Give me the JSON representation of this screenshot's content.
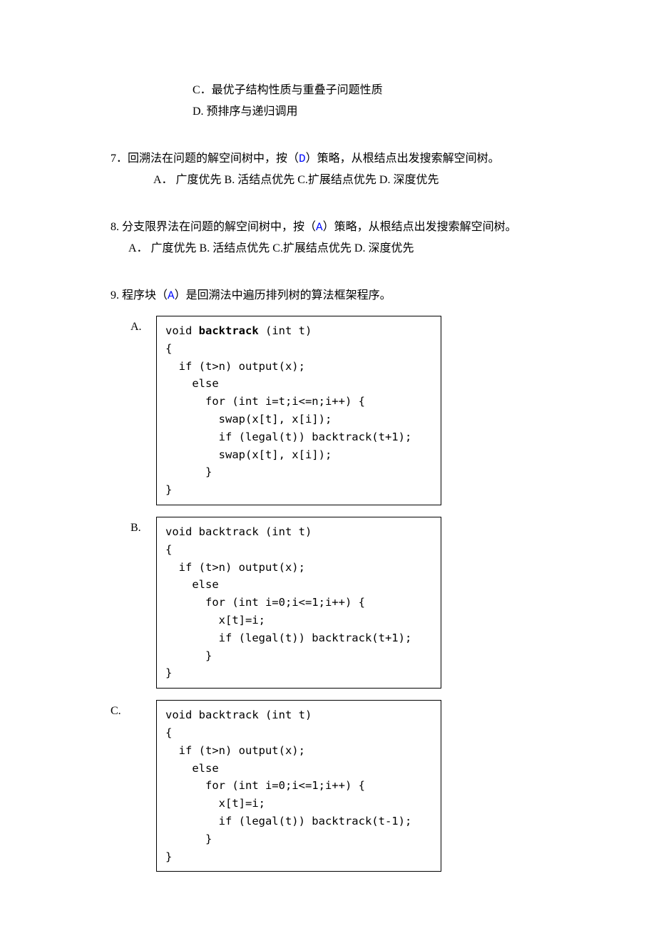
{
  "top_options": {
    "c": "C．最优子结构性质与重叠子问题性质",
    "d": "D.  预排序与递归调用"
  },
  "q7": {
    "text_pre": "7．回溯法在问题的解空间树中，按（",
    "answer": "D",
    "text_post": "）策略，从根结点出发搜索解空间树。",
    "opts": "A． 广度优先 B. 活结点优先  C.扩展结点优先  D. 深度优先"
  },
  "q8": {
    "text_pre": "8. 分支限界法在问题的解空间树中，按（",
    "answer": "A",
    "text_post": "）策略，从根结点出发搜索解空间树。",
    "opts": "A． 广度优先 B. 活结点优先  C.扩展结点优先  D. 深度优先"
  },
  "q9": {
    "text_pre": "9. 程序块（",
    "answer": "A",
    "text_post": "）是回溯法中遍历排列树的算法框架程序。",
    "A_label": "A.",
    "B_label": "B.",
    "C_label": "C.",
    "codeA": {
      "l1a": "void ",
      "l1b": "backtrack",
      "l1c": " (int t)",
      "l2": "{",
      "l3": "  if (t>n) output(x);",
      "l4": "    else",
      "l5": "      for (int i=t;i<=n;i++) {",
      "l6": "        swap(x[t], x[i]);",
      "l7": "        if (legal(t)) backtrack(t+1);",
      "l8": "        swap(x[t], x[i]);",
      "l9": "      }",
      "l10": "}"
    },
    "codeB": {
      "l1": "void backtrack (int t)",
      "l2": "{",
      "l3": "  if (t>n) output(x);",
      "l4": "    else",
      "l5": "      for (int i=0;i<=1;i++) {",
      "l6": "        x[t]=i;",
      "l7": "        if (legal(t)) backtrack(t+1);",
      "l8": "      }",
      "l9": "}"
    },
    "codeC": {
      "l1": "void backtrack (int t)",
      "l2": "{",
      "l3": "  if (t>n) output(x);",
      "l4": "    else",
      "l5": "      for (int i=0;i<=1;i++) {",
      "l6": "        x[t]=i;",
      "l7": "        if (legal(t)) backtrack(t-1);",
      "l8": "      }",
      "l9": "}"
    }
  }
}
